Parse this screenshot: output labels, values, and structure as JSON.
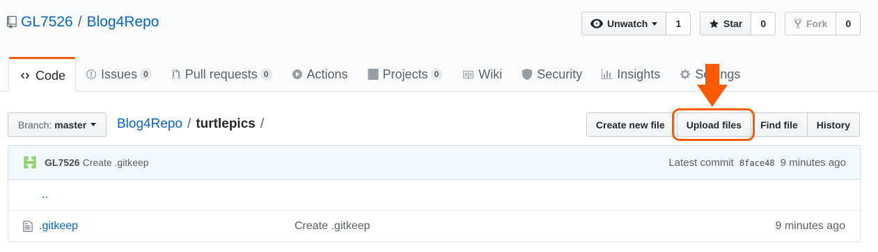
{
  "repo": {
    "owner": "GL7526",
    "separator": "/",
    "name": "Blog4Repo"
  },
  "actions": {
    "watch": {
      "label": "Unwatch",
      "count": "1"
    },
    "star": {
      "label": "Star",
      "count": "0"
    },
    "fork": {
      "label": "Fork",
      "count": "0"
    }
  },
  "tabs": [
    {
      "label": "Code",
      "icon": "code-icon"
    },
    {
      "label": "Issues",
      "count": "0",
      "icon": "issue-icon"
    },
    {
      "label": "Pull requests",
      "count": "0",
      "icon": "pull-request-icon"
    },
    {
      "label": "Actions",
      "icon": "play-icon"
    },
    {
      "label": "Projects",
      "count": "0",
      "icon": "project-icon"
    },
    {
      "label": "Wiki",
      "icon": "book-icon"
    },
    {
      "label": "Security",
      "icon": "shield-icon"
    },
    {
      "label": "Insights",
      "icon": "graph-icon"
    },
    {
      "label": "Settings",
      "icon": "gear-icon"
    }
  ],
  "branch": {
    "label": "Branch:",
    "value": "master"
  },
  "breadcrumb": {
    "root": "Blog4Repo",
    "separator": "/",
    "current": "turtlepics",
    "trailing": "/"
  },
  "file_nav": {
    "create": "Create new file",
    "upload": "Upload files",
    "find": "Find file",
    "history": "History"
  },
  "commit": {
    "author": "GL7526",
    "message": "Create .gitkeep",
    "latest_label": "Latest commit",
    "sha": "8face48",
    "age": "9 minutes ago"
  },
  "files": {
    "up": "..",
    "rows": [
      {
        "name": ".gitkeep",
        "message": "Create .gitkeep",
        "age": "9 minutes ago"
      }
    ]
  },
  "colors": {
    "accent": "#ff5a00",
    "link": "#0366d6",
    "tab_active": "#e36209"
  }
}
